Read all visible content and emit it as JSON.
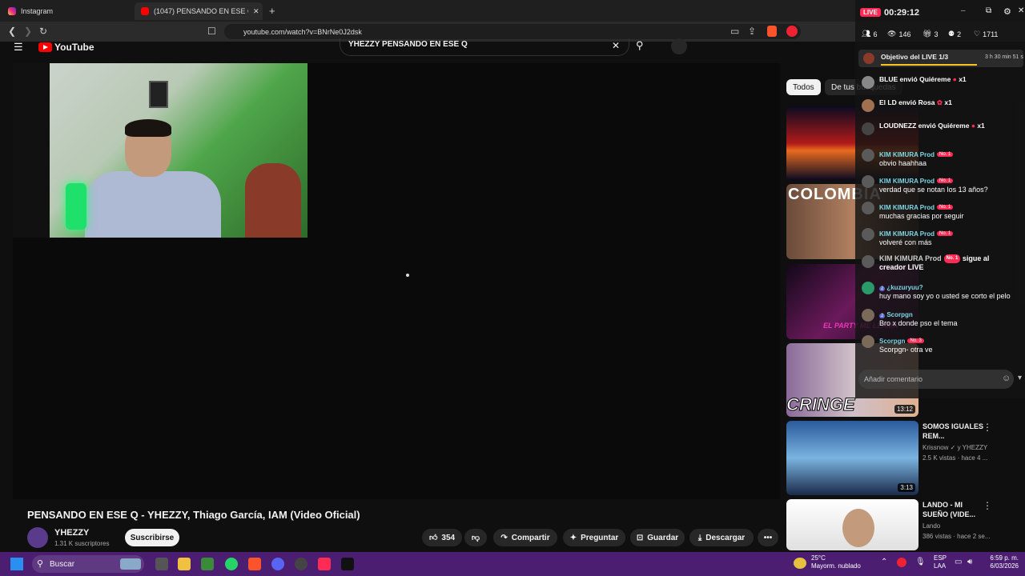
{
  "browser": {
    "tabs": [
      {
        "label": "Instagram"
      },
      {
        "label": "(1047) PENSANDO EN ESE Q - Y..."
      }
    ],
    "new_tab": "+",
    "close": "✕",
    "url": "youtube.com/watch?v=BNrNe0J2dsk"
  },
  "youtube": {
    "logo": "YouTube",
    "search_query": "YHEZZY PENSANDO EN ESE Q",
    "video_title": "PENSANDO EN ESE Q - YHEZZY, Thiago García, IAM (Video Oficial)",
    "channel": "YHEZZY",
    "subscribers": "1.31 K suscriptores",
    "subscribe_label": "Suscribirse",
    "likes": "354",
    "share_label": "Compartir",
    "ask_label": "Preguntar",
    "save_label": "Guardar",
    "download_label": "Descargar",
    "more_label": "•••",
    "chips": [
      "Todos",
      "De tus búsquedas"
    ],
    "recommendations": [
      {
        "duration": "",
        "title": "",
        "channel": "",
        "meta": ""
      },
      {
        "duration": "",
        "title": "",
        "channel": "",
        "meta": ""
      },
      {
        "duration": "",
        "title": "",
        "channel": "",
        "meta": ""
      },
      {
        "duration": "13:12",
        "thumb_text": "CRINGE",
        "title": "",
        "channel": "",
        "meta": ""
      },
      {
        "duration": "3:13",
        "title": "SOMOS IGUALES REM...",
        "channel": "Krissnow ✓ y YHEZZY",
        "meta": "2.5 K vistas · hace 4 ..."
      },
      {
        "duration": "",
        "title": "LANDO - MI SUEÑO (VIDE...",
        "channel": "Lando",
        "meta": "386 vistas · hace 2 se..."
      }
    ],
    "thumb2_text": "COLOMBIA",
    "thumb3_text": "EL PARTY ME LLAMA"
  },
  "live": {
    "badge": "LIVE",
    "time": "00:29:12",
    "stats": [
      "6",
      "146",
      "3",
      "2",
      "1711"
    ],
    "goal_label": "Objetivo del LIVE 1/3",
    "goal_time": "3 h 30 min 51 s",
    "comment_placeholder": "Añadir comentario",
    "comments": [
      {
        "user": "BLUE",
        "text": "envió Quiéreme",
        "count": "x1",
        "gift": true
      },
      {
        "user": "El LD",
        "text": "envió Rosa",
        "count": "x1",
        "gift": true
      },
      {
        "user": "LOUDNEZZ",
        "text": "envió Quiéreme",
        "count": "x1",
        "gift": true
      },
      {
        "user": "KIM KIMURA Prod",
        "badge": "No. 1",
        "text": "obvio haahhaa"
      },
      {
        "user": "KIM KIMURA Prod",
        "badge": "No. 1",
        "text": "verdad que se notan los 13 años?"
      },
      {
        "user": "KIM KIMURA Prod",
        "badge": "No. 1",
        "text": "muchas gracias por seguir"
      },
      {
        "user": "KIM KIMURA Prod",
        "badge": "No. 1",
        "text": "volveré con más"
      },
      {
        "user": "KIM KIMURA Prod",
        "badge": "No. 1",
        "text": "sigue al creador LIVE"
      },
      {
        "user": "¿kuzuryuu?",
        "level": "2",
        "text": "huy mano soy yo o usted se corto el pelo"
      },
      {
        "user": "Scorpgn",
        "level": "2",
        "text": "Bro x donde pso el tema"
      },
      {
        "user": "Scorpgn",
        "badge": "No. 3",
        "text": "Scorpgn- otra ve"
      }
    ]
  },
  "taskbar": {
    "search": "Buscar",
    "weather_temp": "25°C",
    "weather_desc": "Mayorm. nublado",
    "lang1": "ESP",
    "lang2": "LAA",
    "time": "6:59 p. m.",
    "date": "6/03/2026"
  },
  "colors": {
    "accent": "#fe2c55",
    "taskbar": "#4b1e72",
    "yt_red": "#ff0000"
  }
}
